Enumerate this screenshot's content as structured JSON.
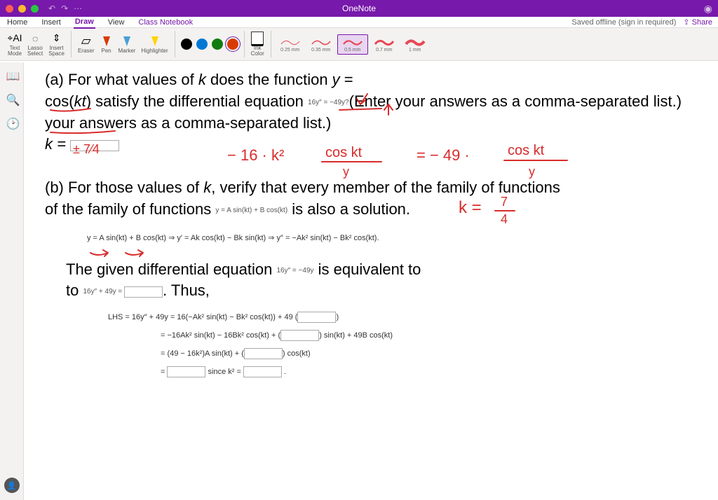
{
  "titlebar": {
    "title": "OneNote",
    "undo": "↶",
    "redo": "↷",
    "more": "⋯"
  },
  "menubar": {
    "home": "Home",
    "insert": "Insert",
    "draw": "Draw",
    "view": "View",
    "classNotebook": "Class Notebook",
    "savedStatus": "Saved offline (sign in required)",
    "share": "Share"
  },
  "ribbon": {
    "textMode": "Text\nMode",
    "lassoSelect": "Lasso\nSelect",
    "insertSpace": "Insert\nSpace",
    "eraser": "Eraser",
    "pen": "Pen",
    "marker": "Marker",
    "highlighter": "Highlighter",
    "inkColor": "Ink\nColor",
    "colors": [
      "#000000",
      "#0078D4",
      "#107C10",
      "#D83B01"
    ],
    "strokes": [
      {
        "label": "0.25 mm",
        "w": 1
      },
      {
        "label": "0.35 mm",
        "w": 1.5
      },
      {
        "label": "0.5 mm",
        "w": 2.2,
        "selected": true
      },
      {
        "label": "0.7 mm",
        "w": 3
      },
      {
        "label": "1 mm",
        "w": 4
      }
    ]
  },
  "content": {
    "partA1": "(a) For what values of ",
    "k": "k",
    "partA2": " does the function ",
    "y": "y",
    "partA3": " = cos(",
    "kt": "kt",
    "partA4": ") satisfy the differential equation ",
    "eqSmall1": "16y″ = −49y?",
    "partA5": "(Enter your answers as a comma-separated list.)",
    "kEquals": "k = ",
    "partB1": "(b) For those values of ",
    "partB2": ", verify that every member of the family of functions ",
    "eqSmall2": "y = A sin(kt) + B cos(kt)",
    "partB3": " is also a solution.",
    "deriv": "y = A sin(kt) + B cos(kt)   ⇒   y′ = Ak cos(kt) − Bk sin(kt)   ⇒   y″ = −Ak² sin(kt) − Bk² cos(kt).",
    "given1": "The given differential equation ",
    "eqSmall3": "16y″ = −49y",
    "given2": " is equivalent to ",
    "eqSmall4": "16y″ + 49y = ",
    "thus": ". Thus,",
    "lhs1": "LHS = 16y″ + 49y = 16(−Ak² sin(kt) − Bk² cos(kt)) + 49",
    "lhs2": "= −16Ak² sin(kt) − 16Bk² cos(kt) + ",
    "lhs2b": " sin(kt) + 49B cos(kt)",
    "lhs3": "= (49 − 16k²)A sin(kt) + ",
    "lhs3b": " cos(kt)",
    "lhs4": "= ",
    "since": " since k² = "
  },
  "ink": {
    "kAnswer": "± ⁷⁄₄",
    "workLine": "− 16 · k²  (cos kt)/y  =  − 49 · (cos kt)/y",
    "kFinal": "k = ⁷⁄₄"
  }
}
